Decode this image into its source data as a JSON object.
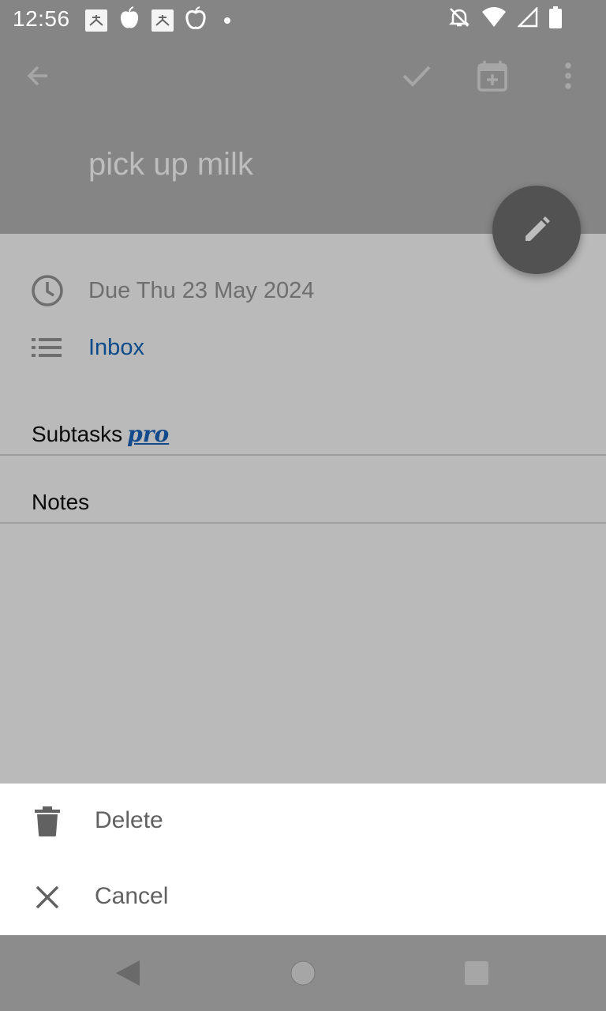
{
  "status_bar": {
    "time": "12:56",
    "notification_icons": [
      "app-icon-1",
      "apple-icon",
      "app-icon-2",
      "apple-bitten-icon",
      "dot-icon"
    ],
    "system_icons": [
      "alarm-off-icon",
      "wifi-icon",
      "signal-icon",
      "battery-icon"
    ]
  },
  "toolbar": {
    "back_icon": "arrow-back-icon",
    "complete_icon": "check-icon",
    "add_to_calendar_icon": "calendar-add-icon",
    "more_icon": "more-vert-icon"
  },
  "task": {
    "title": "pick up milk",
    "due": "Due Thu 23 May 2024",
    "list": "Inbox"
  },
  "sections": {
    "subtasks_label": "Subtasks",
    "subtasks_badge": "pro",
    "notes_label": "Notes"
  },
  "fab": {
    "icon": "edit-pencil-icon"
  },
  "bottom_sheet": {
    "items": [
      {
        "label": "Delete",
        "icon": "trash-icon"
      },
      {
        "label": "Cancel",
        "icon": "close-icon"
      }
    ]
  },
  "nav_bar": {
    "back": "nav-back-icon",
    "home": "nav-home-icon",
    "recents": "nav-recents-icon"
  },
  "colors": {
    "scrim_header": "#858585",
    "content_bg": "#bababa",
    "fab": "#525252",
    "link": "#0d4a8a",
    "sheet_bg": "#ffffff"
  }
}
